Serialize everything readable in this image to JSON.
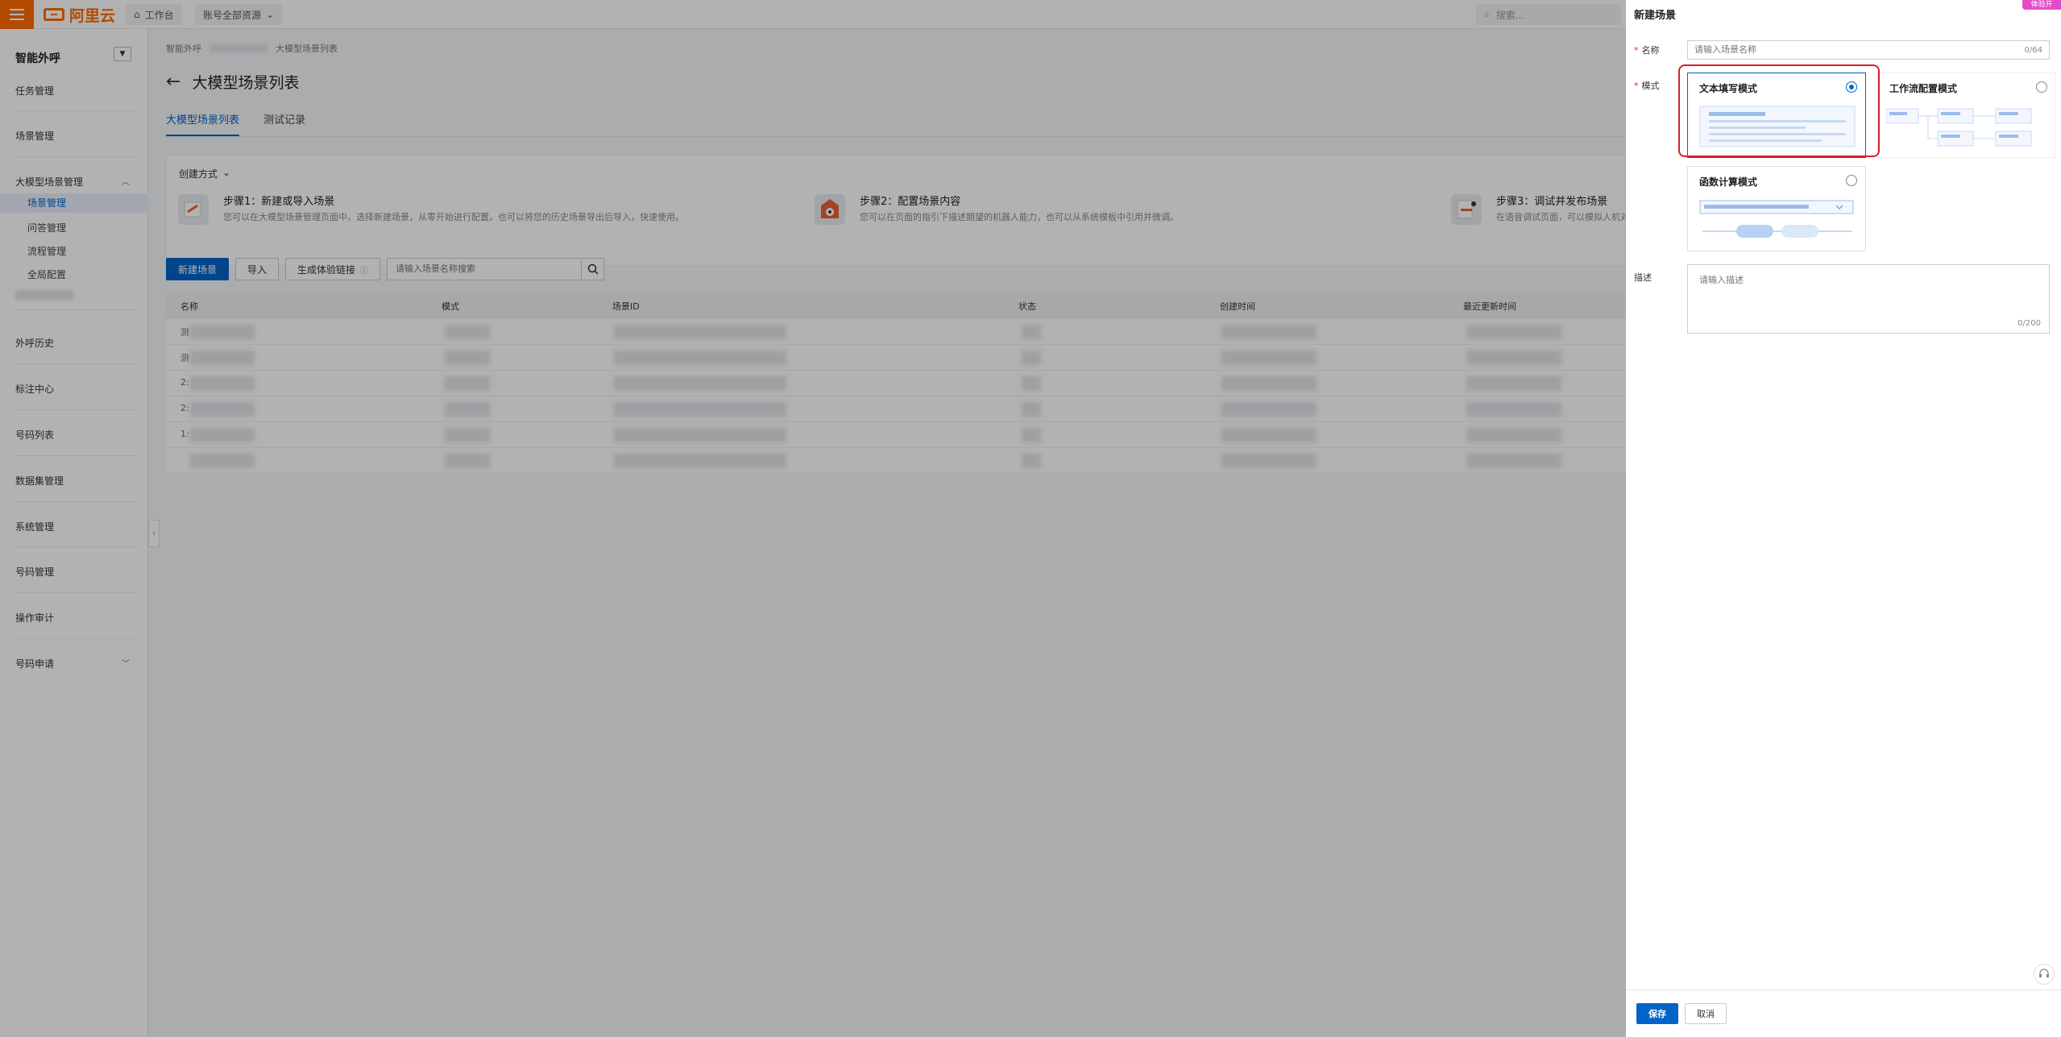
{
  "topbar": {
    "brand": "阿里云",
    "workbench_label": "工作台",
    "scope_label": "账号全部资源",
    "search_placeholder": "搜索..."
  },
  "sidebar": {
    "title": "智能外呼",
    "items": [
      {
        "label": "任务管理"
      },
      {
        "label": "场景管理"
      },
      {
        "label": "大模型场景管理"
      },
      {
        "label": "外呼历史"
      },
      {
        "label": "标注中心"
      },
      {
        "label": "号码列表"
      },
      {
        "label": "数据集管理"
      },
      {
        "label": "系统管理"
      },
      {
        "label": "号码管理"
      },
      {
        "label": "操作审计"
      },
      {
        "label": "号码申请"
      }
    ],
    "sub_items": [
      {
        "label": "场景管理"
      },
      {
        "label": "问答管理"
      },
      {
        "label": "流程管理"
      },
      {
        "label": "全局配置"
      }
    ]
  },
  "breadcrumb": {
    "root": "智能外呼",
    "current": "大模型场景列表"
  },
  "page": {
    "title": "大模型场景列表",
    "tabs": [
      {
        "label": "大模型场景列表"
      },
      {
        "label": "测试记录"
      }
    ]
  },
  "guide": {
    "heading": "创建方式",
    "steps": [
      {
        "title": "步骤1：新建或导入场景",
        "desc": "您可以在大模型场景管理页面中，选择新建场景，从零开始进行配置。也可以将您的历史场景导出后导入，快速使用。"
      },
      {
        "title": "步骤2：配置场景内容",
        "desc": "您可以在页面的指引下描述期望的机器人能力，也可以从系统模板中引用并微调。"
      },
      {
        "title": "步骤3：调试并发布场景",
        "desc": "在语音调试页面，可以模拟人机对"
      }
    ]
  },
  "toolbar": {
    "new_label": "新建场景",
    "import_label": "导入",
    "link_label": "生成体验链接",
    "search_placeholder": "请输入场景名称搜索"
  },
  "table": {
    "headers": [
      "名称",
      "模式",
      "场景ID",
      "状态",
      "创建时间",
      "最近更新时间"
    ],
    "row_leads": [
      "测",
      "测",
      "2:",
      "2:",
      "1:",
      " "
    ]
  },
  "drawer": {
    "title": "新建场景",
    "badge": "体验开",
    "name_label": "名称",
    "name_placeholder": "请输入场景名称",
    "name_counter": "0/64",
    "mode_label": "模式",
    "modes": [
      {
        "label": "文本填写模式",
        "selected": true
      },
      {
        "label": "工作流配置模式",
        "selected": false
      },
      {
        "label": "函数计算模式",
        "selected": false
      }
    ],
    "desc_label": "描述",
    "desc_placeholder": "请输入描述",
    "desc_counter": "0/200",
    "save_label": "保存",
    "cancel_label": "取消"
  },
  "colors": {
    "brand": "#ff6a00",
    "primary": "#0064c8",
    "highlight": "#d9202c"
  }
}
